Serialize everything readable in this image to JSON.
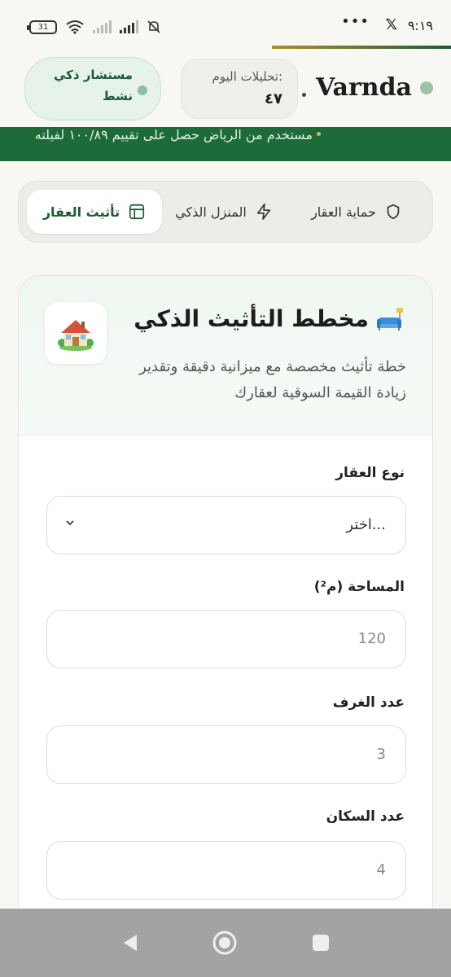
{
  "status_bar": {
    "time": "٩:١٩",
    "battery": "31",
    "dots": "•••"
  },
  "header": {
    "brand": "Varnda",
    "analytics": {
      "label": "تحليلات اليوم:",
      "value": "٤٧"
    },
    "advisor": {
      "title": "مستشار ذكي",
      "status": "نشط"
    }
  },
  "ticker": {
    "text": "مستخدم من الرياض حصل على تقييم ١٠٠/٨٩ لفيلته"
  },
  "tabs": [
    {
      "label": "حماية العقار",
      "icon": "shield-icon",
      "active": false
    },
    {
      "label": "المنزل الذكي",
      "icon": "bolt-icon",
      "active": false
    },
    {
      "label": "تأثيث العقار",
      "icon": "layout-icon",
      "active": true
    }
  ],
  "card": {
    "title": "مخطط التأثيث الذكي",
    "description": "خطة تأثيث مخصصة مع ميزانية دقيقة وتقدير زيادة القيمة السوقية لعقارك",
    "fields": {
      "property_type": {
        "label": "نوع العقار",
        "value": "اختر..."
      },
      "area": {
        "label": "المساحة (م²)",
        "placeholder": "120"
      },
      "rooms": {
        "label": "عدد الغرف",
        "placeholder": "3"
      },
      "residents": {
        "label": "عدد السكان",
        "placeholder": "4"
      }
    }
  },
  "colors": {
    "primary_green": "#1c6b38",
    "accent_gold": "#b08d2e",
    "background": "#f7f7f4"
  }
}
